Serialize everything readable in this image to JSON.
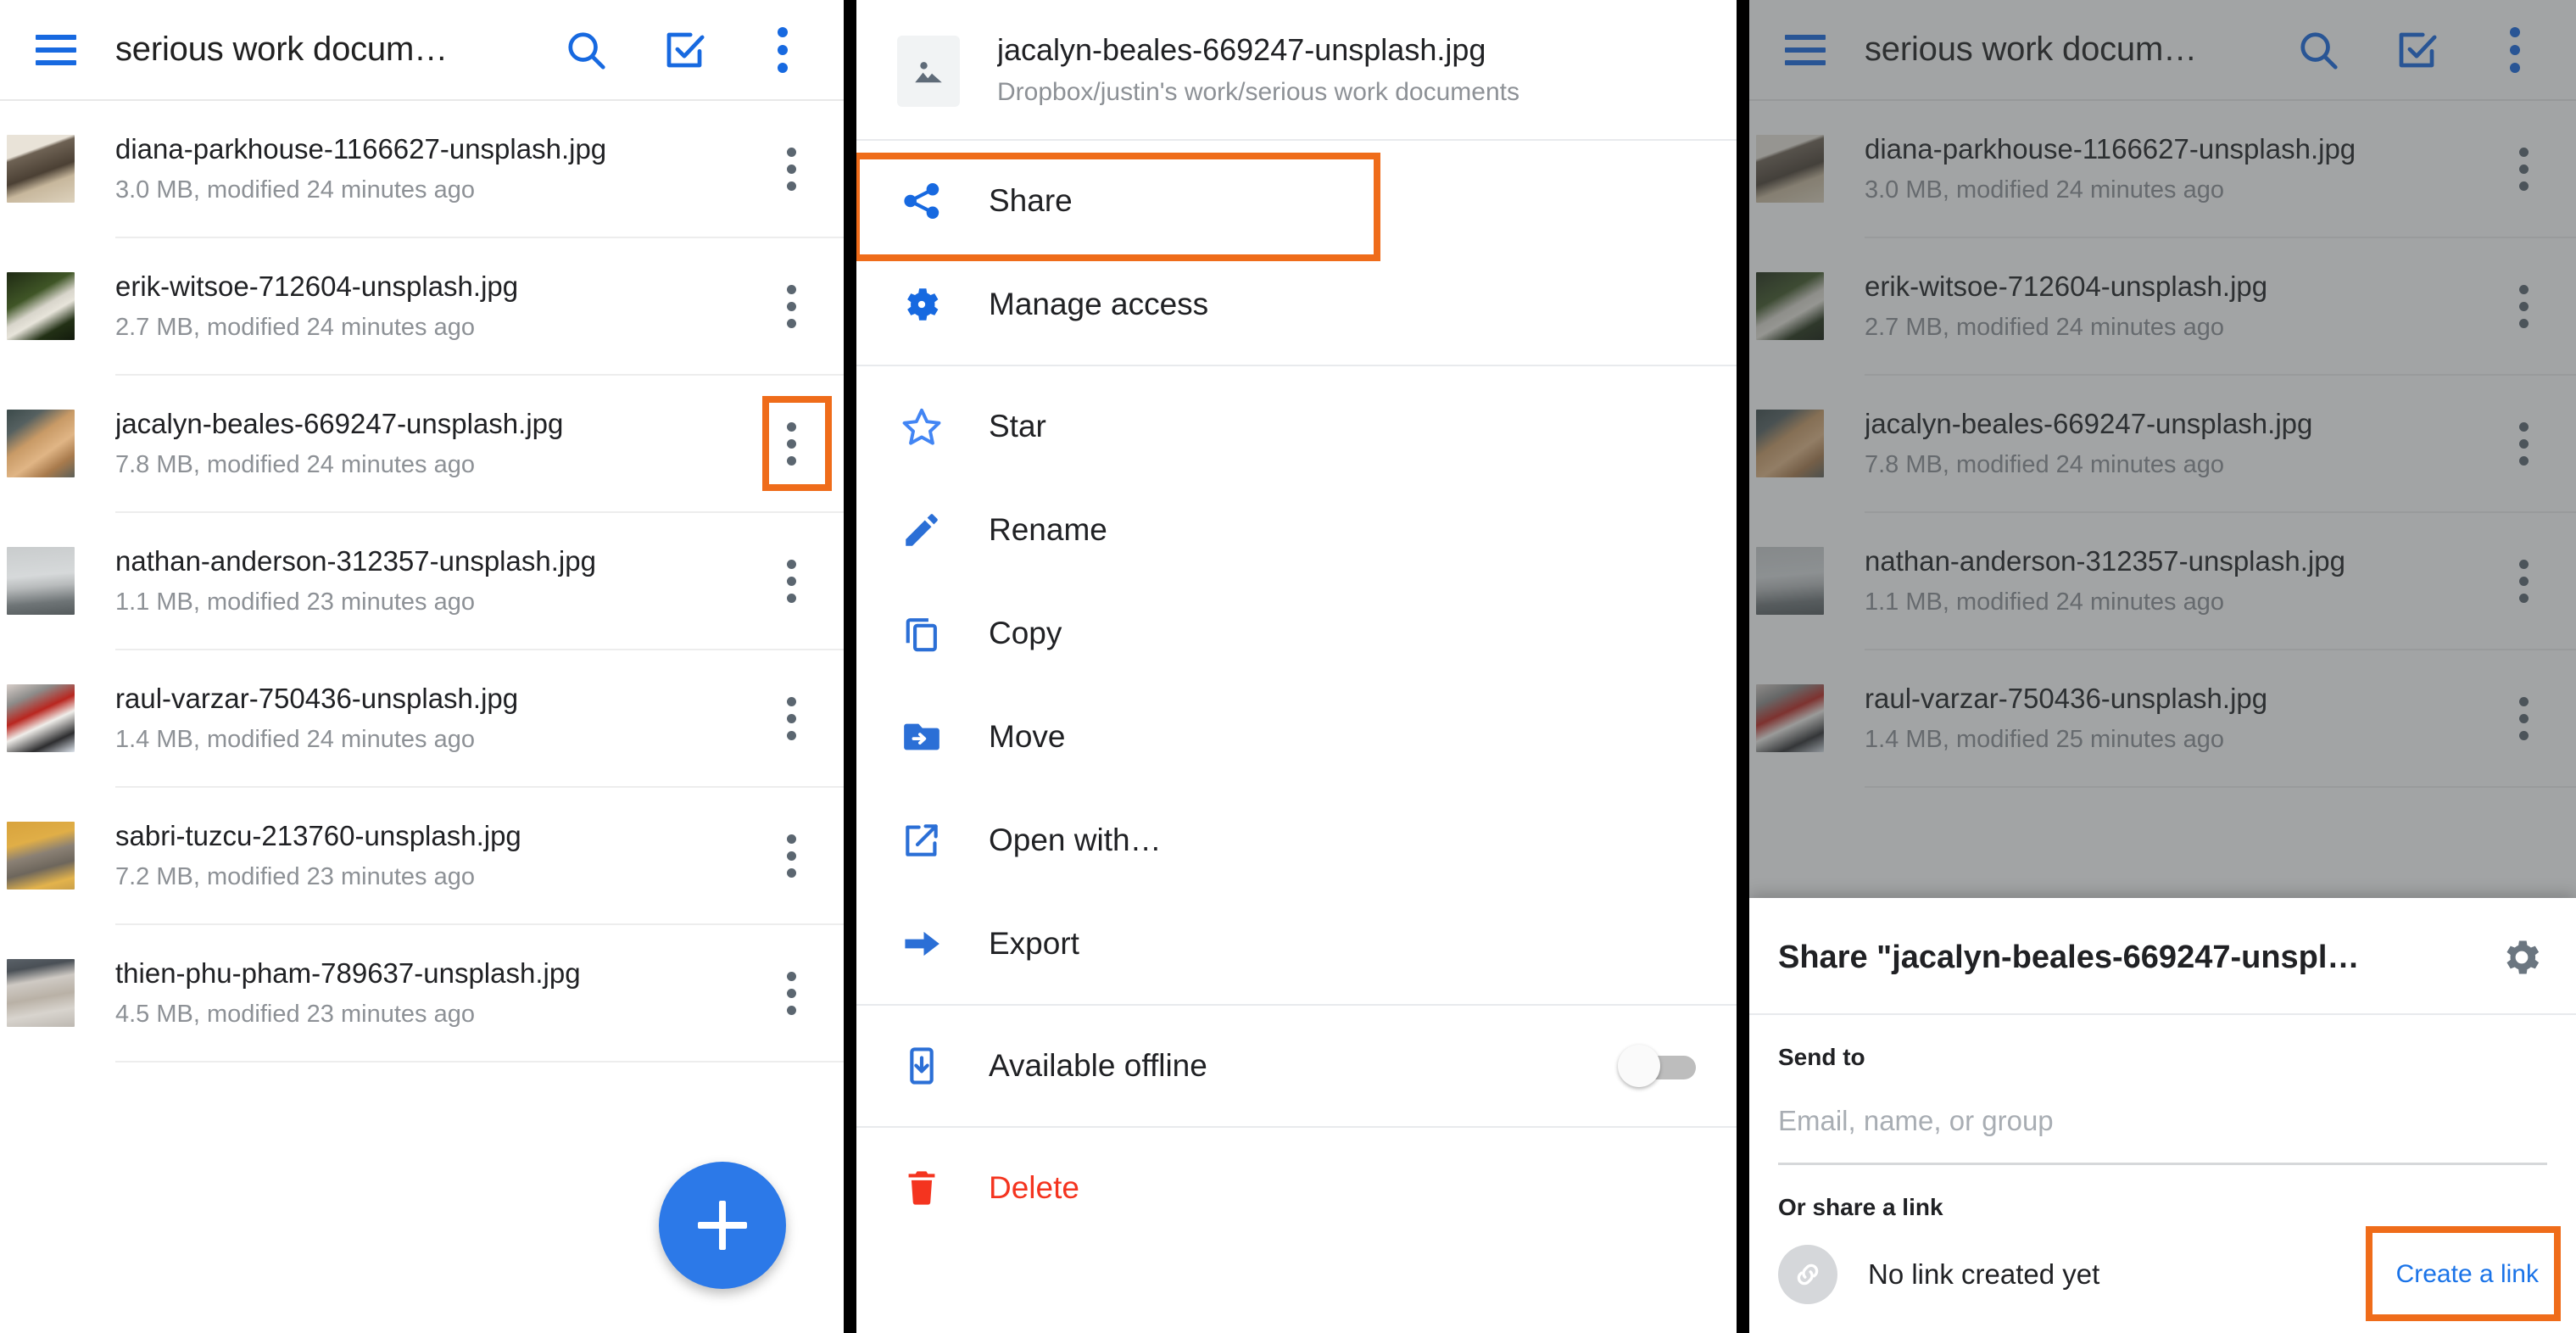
{
  "panel1": {
    "appbar": {
      "menu_icon": "hamburger-icon",
      "title": "serious work docum…",
      "search_icon": "search-icon",
      "select_icon": "checkbox-select-icon",
      "overflow_icon": "overflow-menu-icon"
    },
    "files": [
      {
        "name": "diana-parkhouse-1166627-unsplash.jpg",
        "sub": "3.0 MB, modified 24 minutes ago"
      },
      {
        "name": "erik-witsoe-712604-unsplash.jpg",
        "sub": "2.7 MB, modified 24 minutes ago"
      },
      {
        "name": "jacalyn-beales-669247-unsplash.jpg",
        "sub": "7.8 MB, modified 24 minutes ago"
      },
      {
        "name": "nathan-anderson-312357-unsplash.jpg",
        "sub": "1.1 MB, modified 23 minutes ago"
      },
      {
        "name": "raul-varzar-750436-unsplash.jpg",
        "sub": "1.4 MB, modified 24 minutes ago"
      },
      {
        "name": "sabri-tuzcu-213760-unsplash.jpg",
        "sub": "7.2 MB, modified 23 minutes ago"
      },
      {
        "name": "thien-phu-pham-789637-unsplash.jpg",
        "sub": "4.5 MB, modified 23 minutes ago"
      }
    ],
    "fab": {
      "icon": "plus-icon",
      "label": "+"
    },
    "highlight_color": "#ef6c1a"
  },
  "panel2": {
    "header": {
      "file_icon": "image-file-icon",
      "file_name": "jacalyn-beales-669247-unsplash.jpg",
      "path": "Dropbox/justin's work/serious work documents"
    },
    "menu": [
      {
        "icon": "share-icon",
        "label": "Share",
        "highlighted": true
      },
      {
        "icon": "gear-icon",
        "label": "Manage access",
        "highlighted": false
      },
      {
        "icon": "star-icon",
        "label": "Star",
        "highlighted": false
      },
      {
        "icon": "pencil-icon",
        "label": "Rename",
        "highlighted": false
      },
      {
        "icon": "copy-icon",
        "label": "Copy",
        "highlighted": false
      },
      {
        "icon": "move-folder-icon",
        "label": "Move",
        "highlighted": false
      },
      {
        "icon": "open-with-icon",
        "label": "Open with…",
        "highlighted": false
      },
      {
        "icon": "export-arrow-icon",
        "label": "Export",
        "highlighted": false
      }
    ],
    "offline": {
      "icon": "download-offline-icon",
      "label": "Available offline",
      "toggle_state": "off"
    },
    "delete": {
      "icon": "trash-icon",
      "label": "Delete",
      "color": "#f4341f"
    }
  },
  "panel3": {
    "appbar": {
      "menu_icon": "hamburger-icon",
      "title": "serious work docum…",
      "search_icon": "search-icon",
      "select_icon": "checkbox-select-icon",
      "overflow_icon": "overflow-menu-icon"
    },
    "files": [
      {
        "name": "diana-parkhouse-1166627-unsplash.jpg",
        "sub": "3.0 MB, modified 24 minutes ago"
      },
      {
        "name": "erik-witsoe-712604-unsplash.jpg",
        "sub": "2.7 MB, modified 24 minutes ago"
      },
      {
        "name": "jacalyn-beales-669247-unsplash.jpg",
        "sub": "7.8 MB, modified 24 minutes ago"
      },
      {
        "name": "nathan-anderson-312357-unsplash.jpg",
        "sub": "1.1 MB, modified 24 minutes ago"
      },
      {
        "name": "raul-varzar-750436-unsplash.jpg",
        "sub": "1.4 MB, modified 25 minutes ago"
      }
    ],
    "share_sheet": {
      "title": "Share \"jacalyn-beales-669247-unspl…",
      "settings_icon": "gear-icon",
      "send_to_label": "Send to",
      "recipient_placeholder": "Email, name, or group",
      "recipient_value": "",
      "or_share_label": "Or share a link",
      "link_icon": "link-icon",
      "link_status": "No link created yet",
      "create_link_label": "Create a link"
    }
  }
}
